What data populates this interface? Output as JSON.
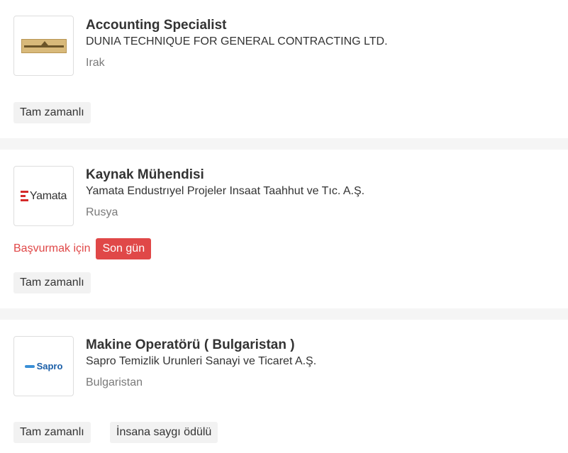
{
  "jobs": [
    {
      "title": "Accounting Specialist",
      "company": "DUNIA TECHNIQUE FOR GENERAL CONTRACTING LTD.",
      "location": "Irak",
      "tags": [
        "Tam zamanlı"
      ],
      "logo": "dunia-logo"
    },
    {
      "title": "Kaynak Mühendisi",
      "company": "Yamata Endustrıyel Projeler Insaat Taahhut ve Tıc. A.Ş.",
      "location": "Rusya",
      "apply_text": "Başvurmak için",
      "deadline_badge": "Son gün",
      "tags": [
        "Tam zamanlı"
      ],
      "logo": "yamata-logo",
      "logo_text": "Yamata"
    },
    {
      "title": "Makine Operatörü ( Bulgaristan )",
      "company": "Sapro Temizlik Urunleri Sanayi ve Ticaret A.Ş.",
      "location": "Bulgaristan",
      "tags": [
        "Tam zamanlı",
        "İnsana saygı ödülü"
      ],
      "logo": "sapro-logo",
      "logo_text": "Sapro"
    }
  ],
  "colors": {
    "accent_red": "#e04848",
    "text": "#333333",
    "muted": "#7a7a7a",
    "tag_bg": "#f2f2f2",
    "separator": "#f5f5f5"
  }
}
